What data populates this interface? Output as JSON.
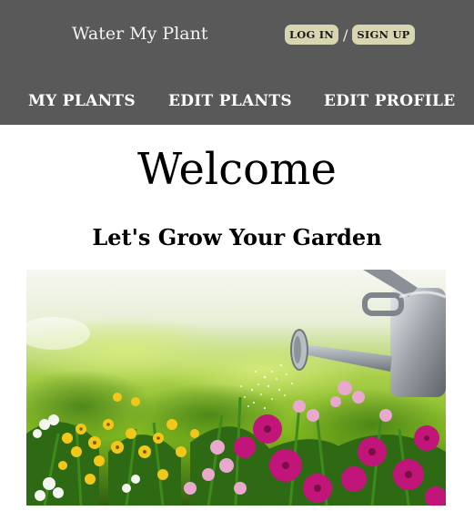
{
  "header": {
    "brand": "Water My Plant",
    "login_label": "LOG IN",
    "separator": "/",
    "signup_label": "SIGN UP",
    "background_color": "#595959",
    "button_color": "#d8d6b1"
  },
  "nav": {
    "items": [
      {
        "label": "MY PLANTS"
      },
      {
        "label": "EDIT PLANTS"
      },
      {
        "label": "EDIT PROFILE"
      }
    ]
  },
  "main": {
    "title": "Welcome",
    "subtitle": "Let's Grow Your Garden",
    "hero_image": "garden-watering-can-image"
  }
}
